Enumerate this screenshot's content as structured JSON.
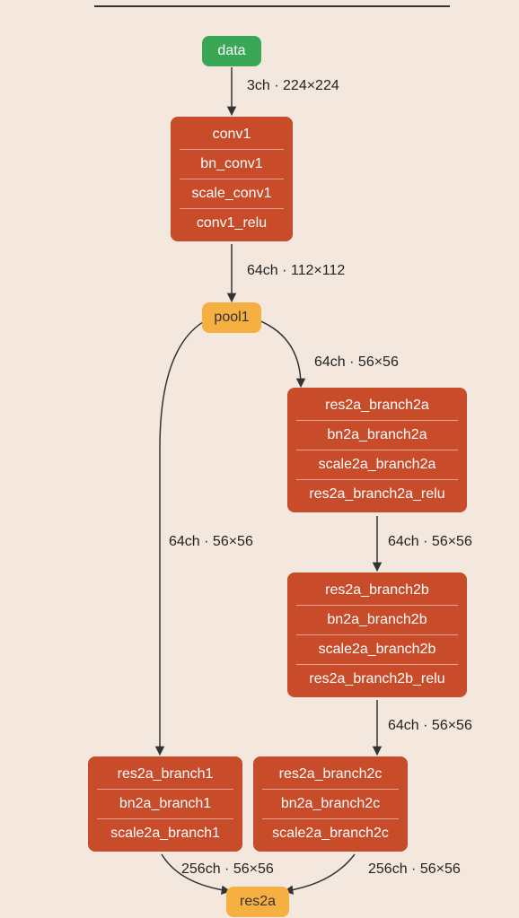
{
  "nodes": {
    "data": {
      "label": "data"
    },
    "conv1_stack": [
      "conv1",
      "bn_conv1",
      "scale_conv1",
      "conv1_relu"
    ],
    "pool1": {
      "label": "pool1"
    },
    "branch2a_stack": [
      "res2a_branch2a",
      "bn2a_branch2a",
      "scale2a_branch2a",
      "res2a_branch2a_relu"
    ],
    "branch2b_stack": [
      "res2a_branch2b",
      "bn2a_branch2b",
      "scale2a_branch2b",
      "res2a_branch2b_relu"
    ],
    "branch1_stack": [
      "res2a_branch1",
      "bn2a_branch1",
      "scale2a_branch1"
    ],
    "branch2c_stack": [
      "res2a_branch2c",
      "bn2a_branch2c",
      "scale2a_branch2c"
    ],
    "res2a": {
      "label": "res2a"
    }
  },
  "edges": {
    "e1": "3ch · 224×224",
    "e2": "64ch · 112×112",
    "e3": "64ch · 56×56",
    "e4": "64ch · 56×56",
    "e5": "64ch · 56×56",
    "e6": "64ch · 56×56",
    "e7": "256ch · 56×56",
    "e8": "256ch · 56×56"
  }
}
